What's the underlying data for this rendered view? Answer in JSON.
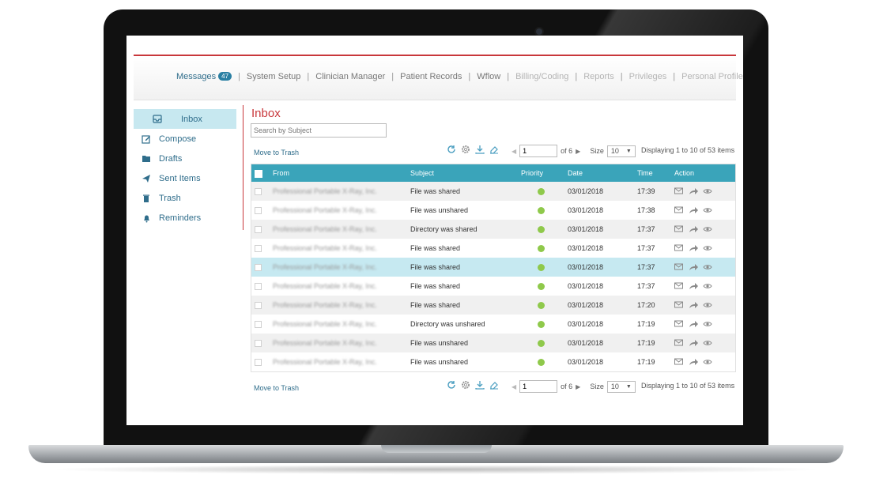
{
  "nav": {
    "items": [
      {
        "label": "Messages",
        "badge": "47",
        "state": "active"
      },
      {
        "label": "System Setup",
        "state": "normal"
      },
      {
        "label": "Clinician Manager",
        "state": "normal"
      },
      {
        "label": "Patient Records",
        "state": "normal"
      },
      {
        "label": "Wflow",
        "state": "normal"
      },
      {
        "label": "Billing/Coding",
        "state": "faded"
      },
      {
        "label": "Reports",
        "state": "faded"
      },
      {
        "label": "Privileges",
        "state": "faded"
      },
      {
        "label": "Personal Profile",
        "state": "faded"
      }
    ],
    "separator": "|"
  },
  "sidebar": {
    "items": [
      {
        "label": "Inbox",
        "icon": "inbox-icon",
        "active": true
      },
      {
        "label": "Compose",
        "icon": "compose-icon"
      },
      {
        "label": "Drafts",
        "icon": "folder-icon"
      },
      {
        "label": "Sent Items",
        "icon": "send-icon"
      },
      {
        "label": "Trash",
        "icon": "trash-icon"
      },
      {
        "label": "Reminders",
        "icon": "bell-icon"
      }
    ]
  },
  "main": {
    "title": "Inbox",
    "search_placeholder": "Search by Subject",
    "move_to_trash": "Move to Trash",
    "pager": {
      "page": "1",
      "of": "of 6",
      "size_label": "Size",
      "size": "10",
      "displaying": "Displaying 1 to 10 of 53 items"
    },
    "columns": {
      "from": "From",
      "subject": "Subject",
      "priority": "Priority",
      "date": "Date",
      "time": "Time",
      "action": "Action"
    },
    "rows": [
      {
        "from": "Professional Portable X-Ray, Inc.",
        "subject": "File was shared",
        "date": "03/01/2018",
        "time": "17:39"
      },
      {
        "from": "Professional Portable X-Ray, Inc.",
        "subject": "File was unshared",
        "date": "03/01/2018",
        "time": "17:38"
      },
      {
        "from": "Professional Portable X-Ray, Inc.",
        "subject": "Directory was shared",
        "date": "03/01/2018",
        "time": "17:37"
      },
      {
        "from": "Professional Portable X-Ray, Inc.",
        "subject": "File was shared",
        "date": "03/01/2018",
        "time": "17:37"
      },
      {
        "from": "Professional Portable X-Ray, Inc.",
        "subject": "File was shared",
        "date": "03/01/2018",
        "time": "17:37",
        "selected": true
      },
      {
        "from": "Professional Portable X-Ray, Inc.",
        "subject": "File was shared",
        "date": "03/01/2018",
        "time": "17:37"
      },
      {
        "from": "Professional Portable X-Ray, Inc.",
        "subject": "File was shared",
        "date": "03/01/2018",
        "time": "17:20"
      },
      {
        "from": "Professional Portable X-Ray, Inc.",
        "subject": "Directory was unshared",
        "date": "03/01/2018",
        "time": "17:19"
      },
      {
        "from": "Professional Portable X-Ray, Inc.",
        "subject": "File was unshared",
        "date": "03/01/2018",
        "time": "17:19"
      },
      {
        "from": "Professional Portable X-Ray, Inc.",
        "subject": "File was unshared",
        "date": "03/01/2018",
        "time": "17:19"
      }
    ]
  },
  "colors": {
    "accent_red": "#c8373b",
    "header_teal": "#3aa4ba",
    "link_blue": "#2f6d8b",
    "priority_green": "#8fc94b",
    "selected_row": "#c6e9f1"
  }
}
